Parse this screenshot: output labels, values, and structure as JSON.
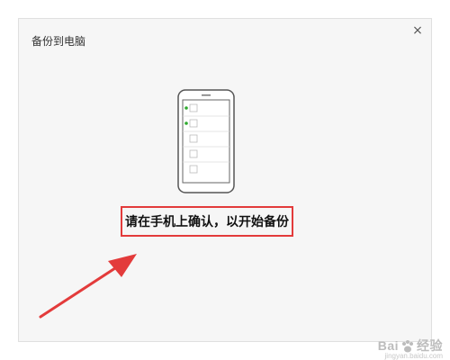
{
  "dialog": {
    "title": "备份到电脑",
    "close_label": "×",
    "message": "请在手机上确认，以开始备份"
  },
  "phone": {
    "rows": [
      {
        "dot": true
      },
      {
        "dot": true
      },
      {
        "dot": false
      },
      {
        "dot": false
      },
      {
        "dot": false
      }
    ]
  },
  "watermark": {
    "brand_left": "Bai",
    "brand_right": "经验",
    "sub": "jingyan.baidu.com"
  },
  "colors": {
    "highlight": "#e33b3b",
    "dot": "#2eaa2e",
    "dialog_bg": "#f6f6f6"
  }
}
